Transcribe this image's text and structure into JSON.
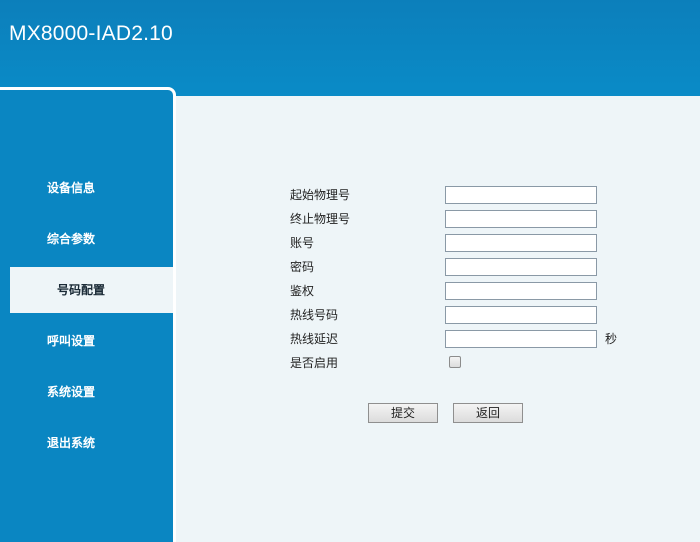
{
  "header": {
    "title": "MX8000-IAD2.10"
  },
  "sidebar": {
    "items": [
      {
        "label": "设备信息"
      },
      {
        "label": "综合参数"
      },
      {
        "label": "号码配置"
      },
      {
        "label": "呼叫设置"
      },
      {
        "label": "系统设置"
      },
      {
        "label": "退出系统"
      }
    ],
    "active_index": 2
  },
  "form": {
    "fields": [
      {
        "label": "起始物理号",
        "value": ""
      },
      {
        "label": "终止物理号",
        "value": ""
      },
      {
        "label": "账号",
        "value": ""
      },
      {
        "label": "密码",
        "value": ""
      },
      {
        "label": "鉴权",
        "value": ""
      },
      {
        "label": "热线号码",
        "value": ""
      },
      {
        "label": "热线延迟",
        "value": "",
        "unit": "秒"
      }
    ],
    "enable": {
      "label": "是否启用",
      "checked": false
    },
    "submit_label": "提交",
    "back_label": "返回"
  },
  "colors": {
    "header": "#0a86c2",
    "content_bg": "#eef5f8",
    "active_item_bg": "#eef5f8"
  }
}
